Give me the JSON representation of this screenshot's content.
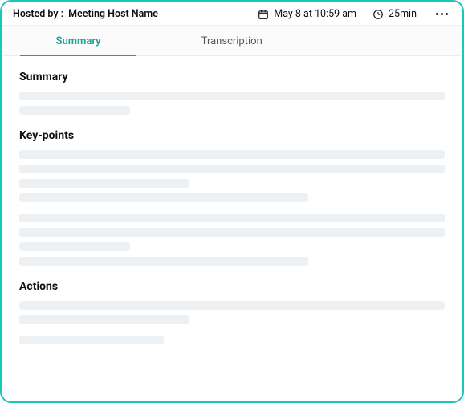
{
  "header": {
    "hosted_label": "Hosted by :",
    "host_name": "Meeting Host Name",
    "date": "May 8 at 10:59 am",
    "duration": "25min"
  },
  "tabs": [
    {
      "label": "Summary",
      "active": true
    },
    {
      "label": "Transcription",
      "active": false
    }
  ],
  "sections": {
    "summary": {
      "title": "Summary"
    },
    "keypoints": {
      "title": "Key-points"
    },
    "actions": {
      "title": "Actions"
    }
  },
  "icons": {
    "calendar": "calendar-icon",
    "clock": "clock-icon",
    "more": "more-icon"
  },
  "colors": {
    "accent_border": "#1ac8b8",
    "accent_tab": "#17a392",
    "skeleton": "#eef1f3"
  }
}
